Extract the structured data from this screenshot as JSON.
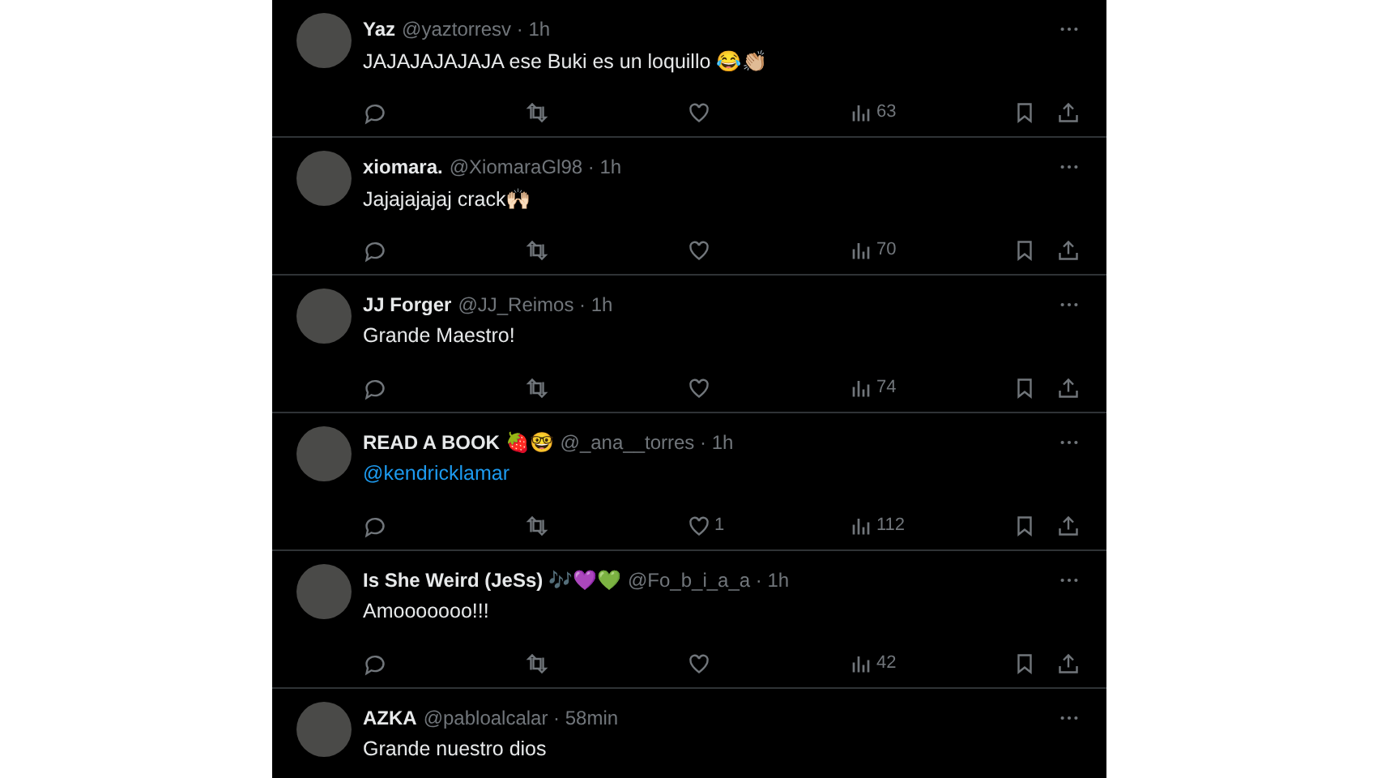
{
  "replies": [
    {
      "name": "Yaz",
      "meta": "@yaztorresv · 1h",
      "text": "JAJAJAJAJAJA ese Buki es un loquillo 😂👏🏼",
      "views": "63"
    },
    {
      "name": "xiomara.",
      "meta": "@XiomaraGl98 · 1h",
      "text": "Jajajajajaj crack🙌🏻",
      "views": "70"
    },
    {
      "name": "JJ Forger",
      "meta": "@JJ_Reimos · 1h",
      "text": "Grande Maestro!",
      "views": "74"
    },
    {
      "name": "READ A BOOK 🍓🤓",
      "meta": "@_ana__torres · 1h",
      "text": "@kendricklamar",
      "mention": true,
      "likes": "1",
      "views": "112"
    },
    {
      "name": "Is She Weird (JeSs) 🎶💜💚",
      "meta": "@Fo_b_i_a_a · 1h",
      "text": "Amooooooo!!!",
      "views": "42"
    },
    {
      "name": "AZKA",
      "meta": "@pabloalcalar · 58min",
      "text": "Grande nuestro dios"
    }
  ]
}
